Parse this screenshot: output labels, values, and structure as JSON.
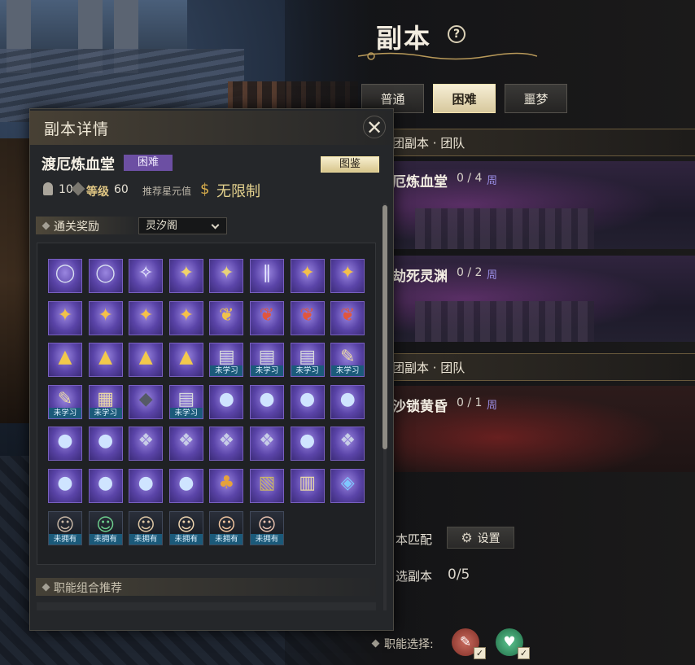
{
  "page": {
    "title": "副本",
    "help": "?"
  },
  "difficulty_tabs": [
    {
      "label": "普通",
      "active": false
    },
    {
      "label": "困难",
      "active": true
    },
    {
      "label": "噩梦",
      "active": false
    }
  ],
  "sections": [
    {
      "label": "团副本 · 团队"
    },
    {
      "label": "团副本 · 团队"
    }
  ],
  "dungeons": [
    {
      "name": "厄炼血堂",
      "count": "0 / 4",
      "period": "周"
    },
    {
      "name": "劫死灵渊",
      "count": "0 / 2",
      "period": "周"
    },
    {
      "name": "沙锁黄昏",
      "count": "0 / 1",
      "period": "周"
    }
  ],
  "match": {
    "label": "本匹配",
    "settings_label": "设置"
  },
  "selected": {
    "label": "选副本",
    "value": "0/5"
  },
  "role": {
    "label": "职能选择:",
    "check": "✓"
  },
  "details": {
    "title": "副本详情",
    "close": "✕",
    "dungeon_name": "渡厄炼血堂",
    "difficulty": "困难",
    "atlas_label": "图鉴",
    "players": "10",
    "level_label": "等级",
    "level": "60",
    "star_label": "推荐星元值",
    "star_value": "无限制",
    "reward_label": "通关奖励",
    "reward_source": "灵汐阁",
    "combo_label": "职能组合推荐"
  },
  "tags": {
    "unlearned": "未学习",
    "unowned": "未拥有"
  },
  "colors": {
    "accent_gold": "#e1c784",
    "tab_active": "#f0e4bd",
    "difficulty_badge": "#6c4fa3",
    "item_purple": "#6a52b8",
    "tag_teal": "#1b5a7a",
    "week_text": "#9a8ee6"
  },
  "reward_items": [
    {
      "icon": "pearl-orb",
      "glyph": "◯",
      "color": "#d8dff0",
      "tag": ""
    },
    {
      "icon": "pearl-orb",
      "glyph": "◯",
      "color": "#d8dff0",
      "tag": ""
    },
    {
      "icon": "spirit-beast",
      "glyph": "✧",
      "color": "#eef2ff",
      "tag": ""
    },
    {
      "icon": "gold-beast",
      "glyph": "✦",
      "color": "#f2d36a",
      "tag": ""
    },
    {
      "icon": "gold-beast",
      "glyph": "✦",
      "color": "#e8d27a",
      "tag": ""
    },
    {
      "icon": "jade-boots",
      "glyph": "∥",
      "color": "#e6e8ff",
      "tag": ""
    },
    {
      "icon": "gold-charm",
      "glyph": "✦",
      "color": "#f4c04a",
      "tag": ""
    },
    {
      "icon": "gold-charm",
      "glyph": "✦",
      "color": "#f4c04a",
      "tag": ""
    },
    {
      "icon": "red-pendant",
      "glyph": "✦",
      "color": "#f0c24a",
      "tag": ""
    },
    {
      "icon": "gold-charm",
      "glyph": "✦",
      "color": "#f4c04a",
      "tag": ""
    },
    {
      "icon": "gold-charm",
      "glyph": "✦",
      "color": "#f4c04a",
      "tag": ""
    },
    {
      "icon": "gold-charm",
      "glyph": "✦",
      "color": "#f4c04a",
      "tag": ""
    },
    {
      "icon": "red-pendant",
      "glyph": "❦",
      "color": "#f0c24a",
      "tag": ""
    },
    {
      "icon": "red-pendant",
      "glyph": "❦",
      "color": "#e0563e",
      "tag": ""
    },
    {
      "icon": "red-pendant",
      "glyph": "❦",
      "color": "#e0563e",
      "tag": ""
    },
    {
      "icon": "red-pendant",
      "glyph": "❦",
      "color": "#e0563e",
      "tag": ""
    },
    {
      "icon": "gold-ingot",
      "glyph": "▲",
      "color": "#f2c94c",
      "tag": ""
    },
    {
      "icon": "gold-ingot",
      "glyph": "▲",
      "color": "#f2c94c",
      "tag": ""
    },
    {
      "icon": "gold-ingot",
      "glyph": "▲",
      "color": "#f2c94c",
      "tag": ""
    },
    {
      "icon": "gold-ingot",
      "glyph": "▲",
      "color": "#f2c94c",
      "tag": ""
    },
    {
      "icon": "skill-book",
      "glyph": "▤",
      "color": "#d5d8dc",
      "tag": "unlearned"
    },
    {
      "icon": "skill-book",
      "glyph": "▤",
      "color": "#d5d8dc",
      "tag": "unlearned"
    },
    {
      "icon": "skill-book",
      "glyph": "▤",
      "color": "#d5d8dc",
      "tag": "unlearned"
    },
    {
      "icon": "scroll",
      "glyph": "✎",
      "color": "#e8d6a6",
      "tag": "unlearned"
    },
    {
      "icon": "scroll",
      "glyph": "✎",
      "color": "#e8d6a6",
      "tag": "unlearned"
    },
    {
      "icon": "scroll-map",
      "glyph": "▦",
      "color": "#e8d6a6",
      "tag": "unlearned"
    },
    {
      "icon": "dark-shard",
      "glyph": "◆",
      "color": "#555a66",
      "tag": ""
    },
    {
      "icon": "skill-book",
      "glyph": "▤",
      "color": "#d5d8dc",
      "tag": "unlearned"
    },
    {
      "icon": "money-pouch",
      "glyph": "●",
      "color": "#cfe4ff",
      "tag": ""
    },
    {
      "icon": "money-pouch",
      "glyph": "●",
      "color": "#cfe4ff",
      "tag": ""
    },
    {
      "icon": "money-pouch",
      "glyph": "●",
      "color": "#cfe4ff",
      "tag": ""
    },
    {
      "icon": "money-pouch",
      "glyph": "●",
      "color": "#cfe4ff",
      "tag": ""
    },
    {
      "icon": "money-pouch",
      "glyph": "●",
      "color": "#cfe4ff",
      "tag": ""
    },
    {
      "icon": "money-pouch",
      "glyph": "●",
      "color": "#cfe4ff",
      "tag": ""
    },
    {
      "icon": "fabric-roll",
      "glyph": "❖",
      "color": "#c7cde6",
      "tag": ""
    },
    {
      "icon": "fabric-roll",
      "glyph": "❖",
      "color": "#c7cde6",
      "tag": ""
    },
    {
      "icon": "fabric-roll",
      "glyph": "❖",
      "color": "#c7cde6",
      "tag": ""
    },
    {
      "icon": "fabric-roll",
      "glyph": "❖",
      "color": "#c7cde6",
      "tag": ""
    },
    {
      "icon": "money-pouch",
      "glyph": "●",
      "color": "#cfe4ff",
      "tag": ""
    },
    {
      "icon": "fabric-roll",
      "glyph": "❖",
      "color": "#c7cde6",
      "tag": ""
    },
    {
      "icon": "money-pouch",
      "glyph": "●",
      "color": "#cfe4ff",
      "tag": ""
    },
    {
      "icon": "money-pouch",
      "glyph": "●",
      "color": "#cfe4ff",
      "tag": ""
    },
    {
      "icon": "money-pouch",
      "glyph": "●",
      "color": "#cfe4ff",
      "tag": ""
    },
    {
      "icon": "money-pouch",
      "glyph": "●",
      "color": "#cfe4ff",
      "tag": ""
    },
    {
      "icon": "treasure-bag",
      "glyph": "♣",
      "color": "#e6a23c",
      "tag": ""
    },
    {
      "icon": "treasure-map",
      "glyph": "▧",
      "color": "#c9b46a",
      "tag": ""
    },
    {
      "icon": "parchment",
      "glyph": "▥",
      "color": "#e6d5a8",
      "tag": ""
    },
    {
      "icon": "blue-gem",
      "glyph": "◈",
      "color": "#7fc7ff",
      "tag": ""
    },
    {
      "icon": "character-portrait",
      "glyph": "☺",
      "color": "#c9b8a6",
      "tag": "unowned"
    },
    {
      "icon": "character-portrait",
      "glyph": "☺",
      "color": "#6ecf8e",
      "tag": "unowned"
    },
    {
      "icon": "character-portrait",
      "glyph": "☺",
      "color": "#e0c9a6",
      "tag": "unowned"
    },
    {
      "icon": "character-portrait",
      "glyph": "☺",
      "color": "#f0d6b0",
      "tag": "unowned"
    },
    {
      "icon": "character-portrait",
      "glyph": "☺",
      "color": "#f2c6a0",
      "tag": "unowned"
    },
    {
      "icon": "character-portrait",
      "glyph": "☺",
      "color": "#e8c2b0",
      "tag": "unowned"
    }
  ]
}
